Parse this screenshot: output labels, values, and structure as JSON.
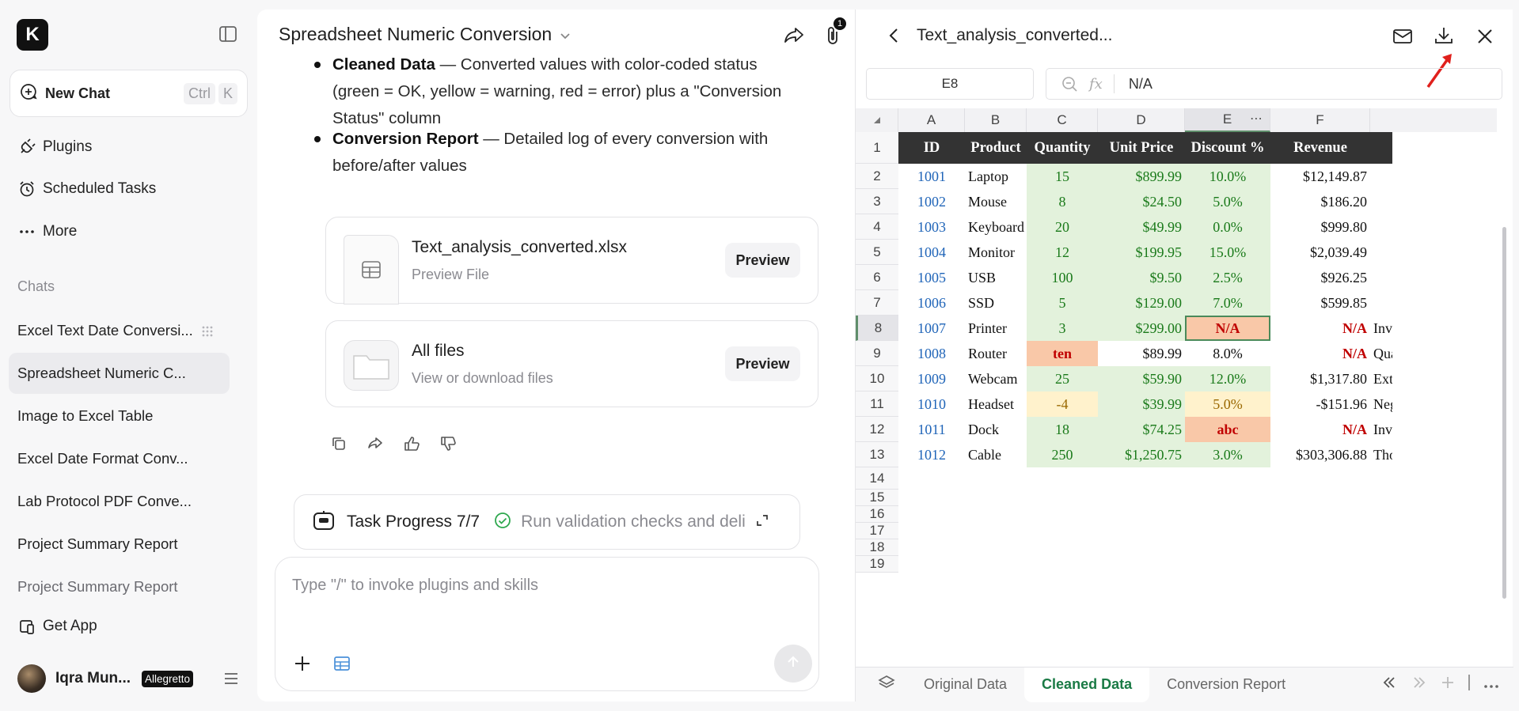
{
  "sidebar": {
    "logo_letter": "K",
    "new_chat": {
      "label": "New Chat",
      "kbd_ctrl": "Ctrl",
      "kbd_k": "K"
    },
    "nav": [
      {
        "label": "Plugins",
        "icon": "plug-icon"
      },
      {
        "label": "Scheduled Tasks",
        "icon": "alarm-clock-icon"
      },
      {
        "label": "More",
        "icon": "more-dots-icon"
      }
    ],
    "chats_title": "Chats",
    "chats": [
      {
        "label": "Excel Text Date Conversi..."
      },
      {
        "label": "Spreadsheet Numeric C..."
      },
      {
        "label": "Image to Excel Table"
      },
      {
        "label": "Excel Date Format Conv..."
      },
      {
        "label": "Lab Protocol PDF Conve..."
      },
      {
        "label": "Project Summary Report"
      },
      {
        "label": "Project Summary Report"
      }
    ],
    "get_app": "Get App",
    "user": {
      "name": "Iqra Mun...",
      "badge": "Allegretto"
    }
  },
  "main": {
    "title": "Spreadsheet Numeric Conversion",
    "attachment_count": "1",
    "bullets": [
      {
        "bold": "Cleaned Data",
        "text": " — Converted values with color-coded status (green = OK, yellow = warning, red = error) plus a \"Conversion Status\" column"
      },
      {
        "bold": "Conversion Report",
        "text": " — Detailed log of every conversion with before/after values"
      }
    ],
    "files": [
      {
        "name": "Text_analysis_converted.xlsx",
        "sub": "Preview File",
        "button": "Preview"
      },
      {
        "name": "All files",
        "sub": "View or download files",
        "button": "Preview"
      }
    ],
    "task": {
      "label": "Task Progress 7/7",
      "status": "Run validation checks and deli"
    },
    "input_placeholder": "Type \"/\" to invoke plugins and skills"
  },
  "panel": {
    "title": "Text_analysis_converted...",
    "cell_ref": "E8",
    "formula_value": "N/A",
    "columns": [
      "A",
      "B",
      "C",
      "D",
      "E",
      "F"
    ],
    "row_numbers": [
      "1",
      "2",
      "3",
      "4",
      "5",
      "6",
      "7",
      "8",
      "9",
      "10",
      "11",
      "12",
      "13",
      "14",
      "15",
      "16",
      "17",
      "18",
      "19"
    ],
    "header": [
      "ID",
      "Product",
      "Quantity",
      "Unit Price",
      "Discount %",
      "Revenue"
    ],
    "rows": [
      {
        "id": "1001",
        "product": "Laptop",
        "qty": "15",
        "price": "$899.99",
        "disc": "10.0%",
        "rev": "$12,149.87",
        "g": "",
        "q": "ok",
        "p": "ok",
        "d": "ok",
        "r": "plain"
      },
      {
        "id": "1002",
        "product": "Mouse",
        "qty": "8",
        "price": "$24.50",
        "disc": "5.0%",
        "rev": "$186.20",
        "g": "",
        "q": "ok",
        "p": "ok",
        "d": "ok",
        "r": "plain"
      },
      {
        "id": "1003",
        "product": "Keyboard",
        "qty": "20",
        "price": "$49.99",
        "disc": "0.0%",
        "rev": "$999.80",
        "g": "",
        "q": "ok",
        "p": "ok",
        "d": "ok",
        "r": "plain"
      },
      {
        "id": "1004",
        "product": "Monitor",
        "qty": "12",
        "price": "$199.95",
        "disc": "15.0%",
        "rev": "$2,039.49",
        "g": "",
        "q": "ok",
        "p": "ok",
        "d": "ok",
        "r": "plain"
      },
      {
        "id": "1005",
        "product": "USB",
        "qty": "100",
        "price": "$9.50",
        "disc": "2.5%",
        "rev": "$926.25",
        "g": "",
        "q": "ok",
        "p": "ok",
        "d": "ok",
        "r": "plain"
      },
      {
        "id": "1006",
        "product": "SSD",
        "qty": "5",
        "price": "$129.00",
        "disc": "7.0%",
        "rev": "$599.85",
        "g": "",
        "q": "ok",
        "p": "ok",
        "d": "ok",
        "r": "plain"
      },
      {
        "id": "1007",
        "product": "Printer",
        "qty": "3",
        "price": "$299.00",
        "disc": "N/A",
        "rev": "N/A",
        "g": "Inva",
        "q": "ok",
        "p": "ok",
        "d": "err",
        "r": "err"
      },
      {
        "id": "1008",
        "product": "Router",
        "qty": "ten",
        "price": "$89.99",
        "disc": "8.0%",
        "rev": "N/A",
        "g": "Qua",
        "q": "err",
        "p": "plain",
        "d": "plain",
        "r": "err"
      },
      {
        "id": "1009",
        "product": "Webcam",
        "qty": "25",
        "price": "$59.90",
        "disc": "12.0%",
        "rev": "$1,317.80",
        "g": "Extr",
        "q": "ok",
        "p": "ok",
        "d": "ok",
        "r": "plain"
      },
      {
        "id": "1010",
        "product": "Headset",
        "qty": "-4",
        "price": "$39.99",
        "disc": "5.0%",
        "rev": "-$151.96",
        "g": "Neg",
        "q": "warn",
        "p": "ok",
        "d": "warn",
        "r": "plain"
      },
      {
        "id": "1011",
        "product": "Dock",
        "qty": "18",
        "price": "$74.25",
        "disc": "abc",
        "rev": "N/A",
        "g": "Inva",
        "q": "ok",
        "p": "ok",
        "d": "err",
        "r": "err"
      },
      {
        "id": "1012",
        "product": "Cable",
        "qty": "250",
        "price": "$1,250.75",
        "disc": "3.0%",
        "rev": "$303,306.88",
        "g": "Tho",
        "q": "ok",
        "p": "ok",
        "d": "ok",
        "r": "plain"
      }
    ],
    "tabs": [
      {
        "label": "Original Data",
        "active": false
      },
      {
        "label": "Cleaned Data",
        "active": true
      },
      {
        "label": "Conversion Report",
        "active": false
      }
    ]
  }
}
